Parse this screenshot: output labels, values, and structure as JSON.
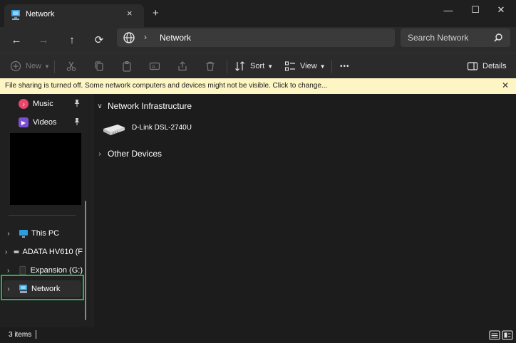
{
  "window": {
    "tab_title": "Network",
    "tab_close": "×",
    "new_tab": "+",
    "controls": {
      "minimize": "—",
      "maximize": "☐",
      "close": "✕"
    }
  },
  "nav": {
    "back": "←",
    "forward": "→",
    "up": "↑",
    "refresh": "⟳"
  },
  "address": {
    "chevron": "›",
    "path": "Network"
  },
  "search": {
    "placeholder": "Search Network"
  },
  "toolbar": {
    "new_label": "New",
    "sort_label": "Sort",
    "view_label": "View",
    "more_label": "•••",
    "details_label": "Details"
  },
  "banner": {
    "text": "File sharing is turned off. Some network computers and devices might not be visible. Click to change...",
    "close": "✕"
  },
  "sidebar": {
    "quick_access": [
      {
        "label": "Music",
        "icon": "music-icon",
        "color": "#e8466b",
        "glyph": "♪"
      },
      {
        "label": "Videos",
        "icon": "videos-icon",
        "color": "#7a4fd6",
        "glyph": "▶"
      }
    ],
    "tree": [
      {
        "label": "This PC",
        "icon": "this-pc-icon",
        "chevron": "›"
      },
      {
        "label": "ADATA HV610 (F",
        "icon": "drive-icon",
        "chevron": "›"
      },
      {
        "label": "Expansion (G:)",
        "icon": "drive-icon",
        "chevron": "›"
      },
      {
        "label": "Network",
        "icon": "network-icon",
        "chevron": "›"
      }
    ]
  },
  "content": {
    "groups": [
      {
        "label": "Network Infrastructure",
        "chevron": "∨"
      },
      {
        "label": "Other Devices",
        "chevron": "›"
      }
    ],
    "devices": [
      {
        "name": "D-Link DSL-2740U",
        "icon": "router-icon"
      }
    ]
  },
  "status": {
    "item_count": "3 items"
  },
  "colors": {
    "accent_green": "#27b05a",
    "banner_bg": "#fdf5c4",
    "window_bg": "#1c1c1c"
  }
}
